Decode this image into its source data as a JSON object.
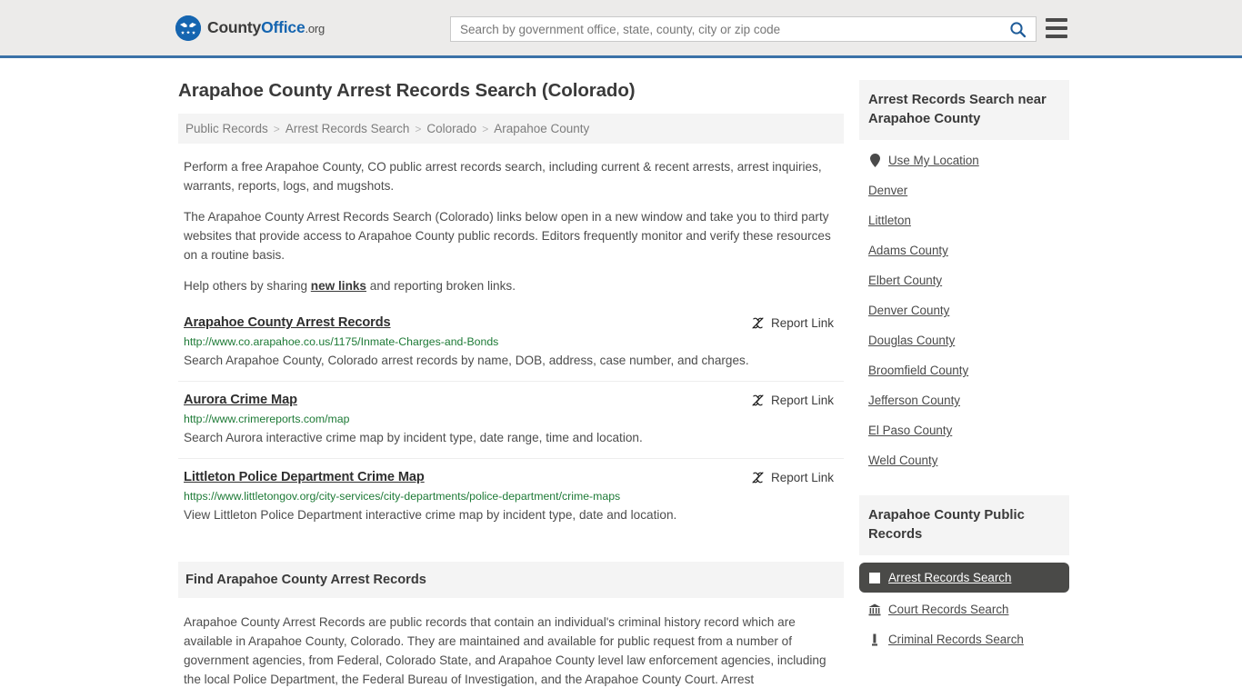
{
  "header": {
    "logo": {
      "icon": "eagle-seal-icon",
      "text_county": "County",
      "text_office": "Office",
      "text_org": ".org"
    },
    "search": {
      "placeholder": "Search by government office, state, county, city or zip code",
      "value": "",
      "icon": "search-icon"
    },
    "menu_icon": "hamburger-menu-icon"
  },
  "main": {
    "title": "Arapahoe County Arrest Records Search (Colorado)",
    "breadcrumb": [
      {
        "label": "Public Records"
      },
      {
        "label": "Arrest Records Search"
      },
      {
        "label": "Colorado"
      },
      {
        "label": "Arapahoe County"
      }
    ],
    "breadcrumb_separator": ">",
    "intro": {
      "p1": "Perform a free Arapahoe County, CO public arrest records search, including current & recent arrests, arrest inquiries, warrants, reports, logs, and mugshots.",
      "p2": "The Arapahoe County Arrest Records Search (Colorado) links below open in a new window and take you to third party websites that provide access to Arapahoe County public records. Editors frequently monitor and verify these resources on a routine basis.",
      "p3_before": "Help others by sharing ",
      "p3_link": "new links",
      "p3_after": " and reporting broken links."
    },
    "report_link_label": "Report Link",
    "report_link_icon": "broken-link-icon",
    "results": [
      {
        "title": "Arapahoe County Arrest Records",
        "url": "http://www.co.arapahoe.co.us/1175/Inmate-Charges-and-Bonds",
        "description": "Search Arapahoe County, Colorado arrest records by name, DOB, address, case number, and charges."
      },
      {
        "title": "Aurora Crime Map",
        "url": "http://www.crimereports.com/map",
        "description": "Search Aurora interactive crime map by incident type, date range, time and location."
      },
      {
        "title": "Littleton Police Department Crime Map",
        "url": "https://www.littletongov.org/city-services/city-departments/police-department/crime-maps",
        "description": "View Littleton Police Department interactive crime map by incident type, date and location."
      }
    ],
    "find_section": {
      "heading": "Find Arapahoe County Arrest Records",
      "body": "Arapahoe County Arrest Records are public records that contain an individual's criminal history record which are available in Arapahoe County, Colorado. They are maintained and available for public request from a number of government agencies, from Federal, Colorado State, and Arapahoe County level law enforcement agencies, including the local Police Department, the Federal Bureau of Investigation, and the Arapahoe County Court. Arrest"
    }
  },
  "sidebar": {
    "nearby": {
      "heading": "Arrest Records Search near Arapahoe County",
      "items": [
        {
          "label": "Use My Location",
          "icon": "map-pin-icon"
        },
        {
          "label": "Denver",
          "icon": ""
        },
        {
          "label": "Littleton",
          "icon": ""
        },
        {
          "label": "Adams County",
          "icon": ""
        },
        {
          "label": "Elbert County",
          "icon": ""
        },
        {
          "label": "Denver County",
          "icon": ""
        },
        {
          "label": "Douglas County",
          "icon": ""
        },
        {
          "label": "Broomfield County",
          "icon": ""
        },
        {
          "label": "Jefferson County",
          "icon": ""
        },
        {
          "label": "El Paso County",
          "icon": ""
        },
        {
          "label": "Weld County",
          "icon": ""
        }
      ]
    },
    "public_records": {
      "heading": "Arapahoe County Public Records",
      "items": [
        {
          "label": "Arrest Records Search",
          "icon": "square-icon",
          "active": true
        },
        {
          "label": "Court Records Search",
          "icon": "courthouse-icon",
          "active": false
        },
        {
          "label": "Criminal Records Search",
          "icon": "gavel-icon",
          "active": false
        }
      ]
    }
  },
  "colors": {
    "accent_blue": "#3b72a8",
    "logo_blue": "#1565b0",
    "url_green": "#1d7a36",
    "active_dark": "#4a4a48",
    "panel_gray": "#f4f4f4"
  }
}
